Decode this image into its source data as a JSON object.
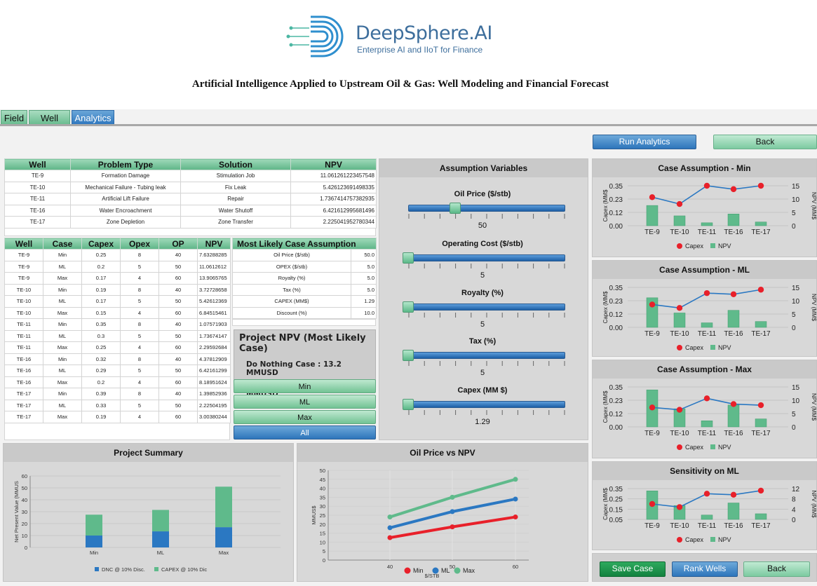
{
  "header": {
    "brand": "DeepSphere.AI",
    "tagline": "Enterprise AI and IIoT for Finance",
    "title": "Artificial Intelligence Applied to Upstream Oil & Gas: Well Modeling and Financial Forecast"
  },
  "tabs": [
    {
      "label": "Field"
    },
    {
      "label": "Well"
    },
    {
      "label": "Analytics"
    }
  ],
  "actions": {
    "run_analytics": "Run Analytics",
    "back_top": "Back",
    "save_case": "Save Case",
    "rank_wells": "Rank Wells",
    "back_bottom": "Back"
  },
  "problem_table": {
    "headers": [
      "Well",
      "Problem Type",
      "Solution",
      "NPV"
    ],
    "rows": [
      [
        "TE-9",
        "Formation Damage",
        "Stimulation Job",
        "11.061261223457548"
      ],
      [
        "TE-10",
        "Mechanical Failure - Tubing leak",
        "Fix Leak",
        "5.426123691498335"
      ],
      [
        "TE-11",
        "Artificial Lift Failure",
        "Repair",
        "1.7367414757382935"
      ],
      [
        "TE-16",
        "Water Encroachment",
        "Water Shutoff",
        "6.421612995681496"
      ],
      [
        "TE-17",
        "Zone Depletion",
        "Zone Transfer",
        "2.225041952780344"
      ]
    ]
  },
  "case_table": {
    "headers": [
      "Well",
      "Case",
      "Capex",
      "Opex",
      "OP",
      "NPV"
    ],
    "rows": [
      [
        "TE-9",
        "Min",
        "0.25",
        "8",
        "40",
        "7.63288285"
      ],
      [
        "TE-9",
        "ML",
        "0.2",
        "5",
        "50",
        "11.0612612"
      ],
      [
        "TE-9",
        "Max",
        "0.17",
        "4",
        "60",
        "13.9065765"
      ],
      [
        "TE-10",
        "Min",
        "0.19",
        "8",
        "40",
        "3.72728658"
      ],
      [
        "TE-10",
        "ML",
        "0.17",
        "5",
        "50",
        "5.42612369"
      ],
      [
        "TE-10",
        "Max",
        "0.15",
        "4",
        "60",
        "6.84515461"
      ],
      [
        "TE-11",
        "Min",
        "0.35",
        "8",
        "40",
        "1.07571903"
      ],
      [
        "TE-11",
        "ML",
        "0.3",
        "5",
        "50",
        "1.73674147"
      ],
      [
        "TE-11",
        "Max",
        "0.25",
        "4",
        "60",
        "2.29592684"
      ],
      [
        "TE-16",
        "Min",
        "0.32",
        "8",
        "40",
        "4.37812909"
      ],
      [
        "TE-16",
        "ML",
        "0.29",
        "5",
        "50",
        "6.42161299"
      ],
      [
        "TE-16",
        "Max",
        "0.2",
        "4",
        "60",
        "8.18951624"
      ],
      [
        "TE-17",
        "Min",
        "0.39",
        "8",
        "40",
        "1.39852936"
      ],
      [
        "TE-17",
        "ML",
        "0.33",
        "5",
        "50",
        "2.22504195"
      ],
      [
        "TE-17",
        "Max",
        "0.19",
        "4",
        "60",
        "3.00380244"
      ]
    ]
  },
  "assumption_table": {
    "header": "Most Likely Case Assumption",
    "rows": [
      [
        "Oil Price ($/stb)",
        "50.0"
      ],
      [
        "OPEX ($/stb)",
        "5.0"
      ],
      [
        "Royalty (%)",
        "5.0"
      ],
      [
        "Tax (%)",
        "5.0"
      ],
      [
        "CAPEX (MM$)",
        "1.29"
      ],
      [
        "Discount (%)",
        "10.0"
      ]
    ]
  },
  "project_npv": {
    "title": "Project NPV (Most Likely Case)",
    "do_nothing": "Do Nothing Case : 13.2 MMUSD",
    "most_likely": "Most Likely Case : 26.9 MMUSD"
  },
  "case_buttons": [
    {
      "label": "Min"
    },
    {
      "label": "ML"
    },
    {
      "label": "Max"
    },
    {
      "label": "All"
    }
  ],
  "assumption_variables": {
    "title": "Assumption Variables",
    "sliders": [
      {
        "label": "Oil Price ($/stb)",
        "value_text": "50",
        "fraction": 0.3
      },
      {
        "label": "Operating Cost ($/stb)",
        "value_text": "5",
        "fraction": 0.0
      },
      {
        "label": "Royalty (%)",
        "value_text": "5",
        "fraction": 0.0
      },
      {
        "label": "Tax (%)",
        "value_text": "5",
        "fraction": 0.0
      },
      {
        "label": "Capex (MM $)",
        "value_text": "1.29",
        "fraction": 0.0
      }
    ]
  },
  "chart_data": [
    {
      "type": "bar",
      "title": "Project Summary",
      "ylabel": "Net Present Value (MMUS",
      "categories": [
        "Min",
        "ML",
        "Max"
      ],
      "ylim": [
        0,
        60
      ],
      "yticks": [
        0,
        10,
        20,
        30,
        40,
        50,
        60
      ],
      "stacked": true,
      "series": [
        {
          "name": "DNC @ 10% Disc.",
          "color": "#2b78c2",
          "values": [
            10,
            13.5,
            17
          ]
        },
        {
          "name": "CAPEX @ 10% Dic",
          "color": "#5fba8b",
          "values": [
            17.5,
            18,
            34
          ]
        }
      ]
    },
    {
      "type": "line",
      "title": "Oil Price vs NPV",
      "xlabel": "$/STB",
      "ylabel": "MMUS$",
      "x": [
        40,
        50,
        60
      ],
      "ylim": [
        0,
        50
      ],
      "yticks": [
        0,
        5,
        10,
        15,
        20,
        25,
        30,
        35,
        40,
        45,
        50
      ],
      "series": [
        {
          "name": "Min",
          "color": "#e8202a",
          "values": [
            12.5,
            18.5,
            24
          ]
        },
        {
          "name": "ML",
          "color": "#2b78c2",
          "values": [
            18,
            27,
            34
          ]
        },
        {
          "name": "Max",
          "color": "#5fba8b",
          "values": [
            24,
            35,
            45
          ]
        }
      ]
    },
    {
      "type": "bar+line",
      "title": "Case Assumption - Min",
      "categories": [
        "TE-9",
        "TE-10",
        "TE-11",
        "TE-16",
        "TE-17"
      ],
      "left_label": "Capex (MM$",
      "right_label": "NPV (MM$",
      "left_ticks": [
        "0.35",
        "0.23",
        "0.12",
        "0.00"
      ],
      "left_range": [
        0,
        0.35
      ],
      "right_ticks": [
        "15",
        "10",
        "5",
        "0"
      ],
      "right_range": [
        0,
        15
      ],
      "series": [
        {
          "name": "Capex",
          "color": "#e8202a",
          "values": [
            0.25,
            0.19,
            0.35,
            0.32,
            0.35
          ]
        },
        {
          "name": "NPV",
          "color": "#5fba8b",
          "values": [
            7.6,
            3.7,
            1.1,
            4.4,
            1.4
          ]
        }
      ]
    },
    {
      "type": "bar+line",
      "title": "Case Assumption - ML",
      "categories": [
        "TE-9",
        "TE-10",
        "TE-11",
        "TE-16",
        "TE-17"
      ],
      "left_label": "Capex (MM$",
      "right_label": "NPV (MM$",
      "left_ticks": [
        "0.35",
        "0.23",
        "0.12",
        "0.00"
      ],
      "left_range": [
        0,
        0.35
      ],
      "right_ticks": [
        "15",
        "10",
        "5",
        "0"
      ],
      "right_range": [
        0,
        15
      ],
      "series": [
        {
          "name": "Capex",
          "color": "#e8202a",
          "values": [
            0.2,
            0.17,
            0.3,
            0.29,
            0.33
          ]
        },
        {
          "name": "NPV",
          "color": "#5fba8b",
          "values": [
            11.1,
            5.4,
            1.7,
            6.4,
            2.2
          ]
        }
      ]
    },
    {
      "type": "bar+line",
      "title": "Case Assumption - Max",
      "categories": [
        "TE-9",
        "TE-10",
        "TE-11",
        "TE-16",
        "TE-17"
      ],
      "left_label": "Capex (MM$",
      "right_label": "NPV (MM$",
      "left_ticks": [
        "0.35",
        "0.23",
        "0.12",
        "0.00"
      ],
      "left_range": [
        0,
        0.35
      ],
      "right_ticks": [
        "15",
        "10",
        "5",
        "0"
      ],
      "right_range": [
        0,
        15
      ],
      "series": [
        {
          "name": "Capex",
          "color": "#e8202a",
          "values": [
            0.17,
            0.15,
            0.25,
            0.2,
            0.19
          ]
        },
        {
          "name": "NPV",
          "color": "#5fba8b",
          "values": [
            13.9,
            6.8,
            2.3,
            8.2,
            3.0
          ]
        }
      ]
    },
    {
      "type": "bar+line",
      "title": "Sensitivity on ML",
      "categories": [
        "TE-9",
        "TE-10",
        "TE-11",
        "TE-16",
        "TE-17"
      ],
      "left_label": "Capex (MM$",
      "right_label": "NPV (MM$",
      "left_ticks": [
        "0.35",
        "0.25",
        "0.15",
        "0.05"
      ],
      "left_range": [
        0.05,
        0.35
      ],
      "right_ticks": [
        "12",
        "8",
        "4",
        "0"
      ],
      "right_range": [
        0,
        12
      ],
      "series": [
        {
          "name": "Capex",
          "color": "#e8202a",
          "values": [
            0.2,
            0.17,
            0.3,
            0.29,
            0.33
          ]
        },
        {
          "name": "NPV",
          "color": "#5fba8b",
          "values": [
            11.1,
            5.4,
            1.7,
            6.4,
            2.2
          ]
        }
      ]
    }
  ]
}
